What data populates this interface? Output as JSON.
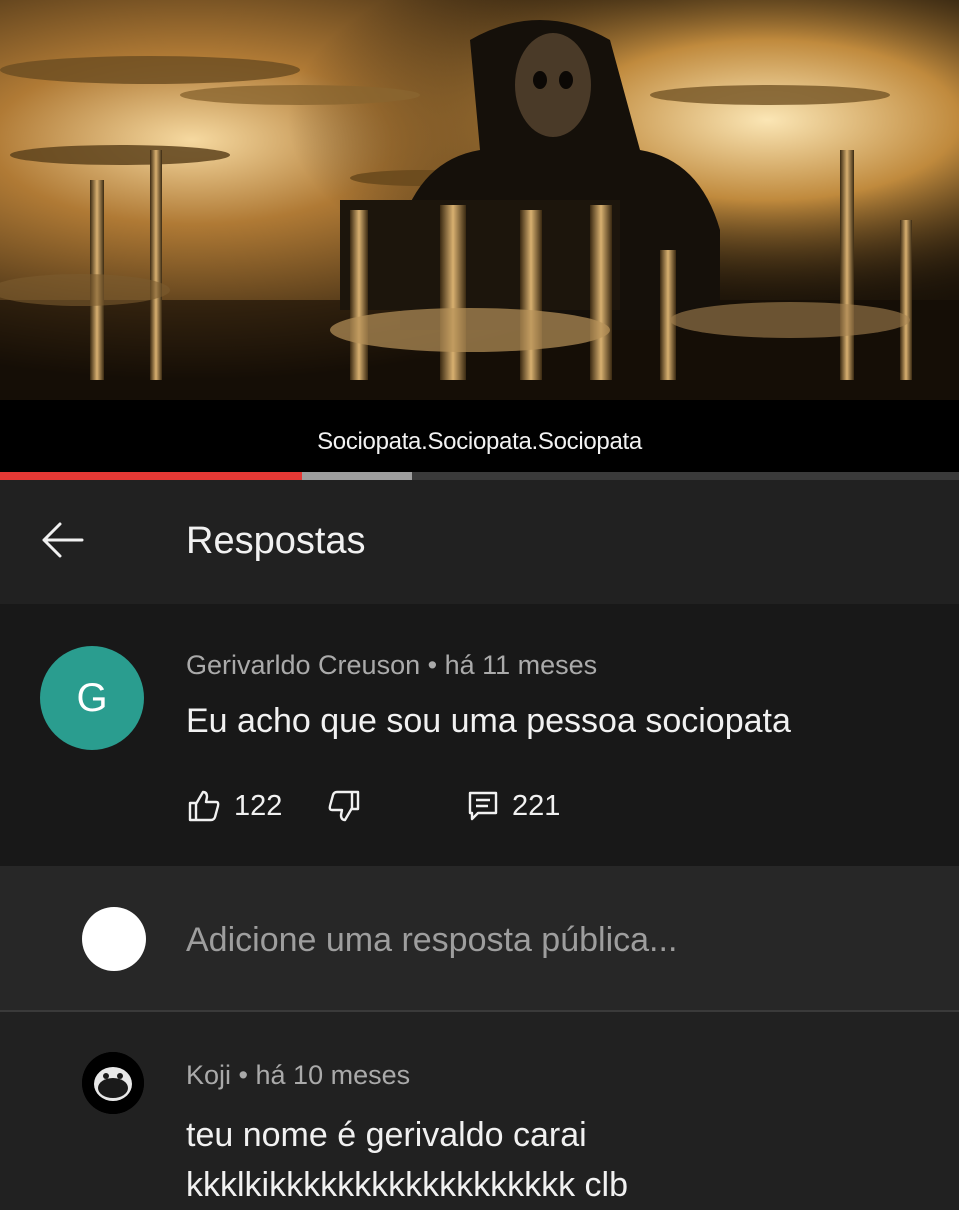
{
  "video": {
    "subtitle": "Sociopata.Sociopata.Sociopata",
    "progress_played": 0.315,
    "progress_buffered": 0.43,
    "colors": {
      "played": "#e53935",
      "buffered": "#9e9e9e"
    }
  },
  "header": {
    "back_icon": "arrow-left-icon",
    "title": "Respostas"
  },
  "parent_comment": {
    "avatar_letter": "G",
    "avatar_color": "#2a9d8f",
    "author": "Gerivarldo Creuson",
    "separator": "•",
    "time": "há 11 meses",
    "text": "Eu acho que sou uma pessoa sociopata",
    "likes": "122",
    "replies": "221",
    "icons": [
      "thumb-up-icon",
      "thumb-down-icon",
      "reply-icon"
    ]
  },
  "reply_input": {
    "placeholder": "Adicione uma resposta pública..."
  },
  "reply": {
    "author": "Koji",
    "separator": "•",
    "time": "há 10 meses",
    "text": "teu nome é gerivaldo carai kkklkikkkkkkkkkkkkkkkkkk clb"
  }
}
